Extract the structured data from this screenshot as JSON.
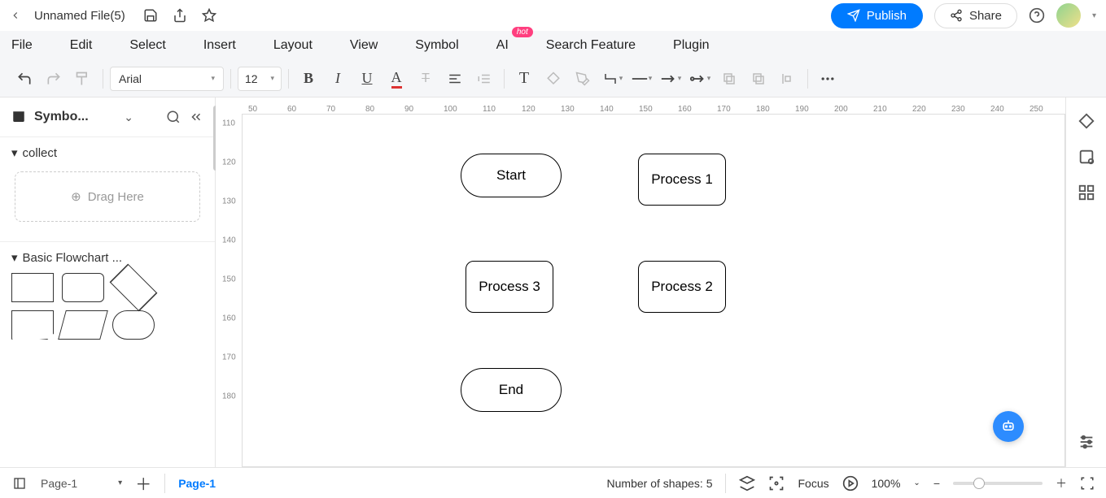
{
  "titlebar": {
    "filename": "Unnamed File(5)",
    "publish": "Publish",
    "share": "Share"
  },
  "menu": {
    "file": "File",
    "edit": "Edit",
    "select": "Select",
    "insert": "Insert",
    "layout": "Layout",
    "view": "View",
    "symbol": "Symbol",
    "ai": "AI",
    "ai_badge": "hot",
    "search_feature": "Search Feature",
    "plugin": "Plugin"
  },
  "toolbar": {
    "font": "Arial",
    "size": "12"
  },
  "sidebar": {
    "title": "Symbo...",
    "sections": {
      "collect": "collect",
      "basic_flowchart": "Basic Flowchart ..."
    },
    "drag_here": "Drag Here"
  },
  "ruler_h": [
    "50",
    "60",
    "70",
    "80",
    "90",
    "100",
    "110",
    "120",
    "130",
    "140",
    "150",
    "160",
    "170",
    "180",
    "190",
    "200",
    "210",
    "220",
    "230",
    "240",
    "250"
  ],
  "ruler_v": [
    "110",
    "120",
    "130",
    "140",
    "150",
    "160",
    "170",
    "180"
  ],
  "canvas": {
    "shapes": {
      "start": "Start",
      "process1": "Process 1",
      "process3": "Process 3",
      "process2": "Process 2",
      "end": "End"
    }
  },
  "status": {
    "page_selector": "Page-1",
    "page_tab": "Page-1",
    "shape_count": "Number of shapes: 5",
    "focus": "Focus",
    "zoom": "100%"
  }
}
